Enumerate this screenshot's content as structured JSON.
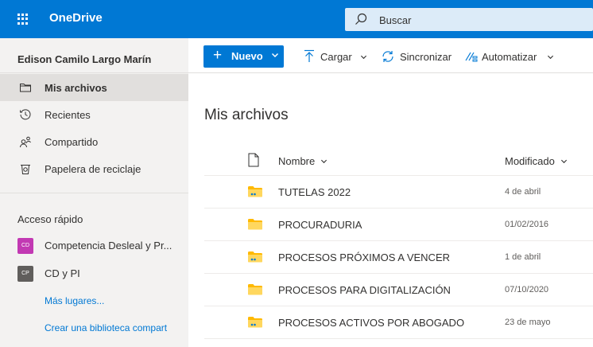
{
  "app": {
    "name": "OneDrive"
  },
  "search": {
    "placeholder": "Buscar"
  },
  "user": {
    "name": "Edison Camilo Largo Marín"
  },
  "nav": {
    "items": [
      {
        "label": "Mis archivos",
        "icon": "folder-icon",
        "active": true
      },
      {
        "label": "Recientes",
        "icon": "clock-icon",
        "active": false
      },
      {
        "label": "Compartido",
        "icon": "people-icon",
        "active": false
      },
      {
        "label": "Papelera de reciclaje",
        "icon": "recycle-bin-icon",
        "active": false
      }
    ]
  },
  "quick_access": {
    "title": "Acceso rápido",
    "items": [
      {
        "badge": "CD",
        "label": "Competencia Desleal y Pr...",
        "color": "#c239b3"
      },
      {
        "badge": "CP",
        "label": "CD y PI",
        "color": "#605e5c"
      }
    ],
    "more_places": "Más lugares...",
    "create_library": "Crear una biblioteca compart"
  },
  "toolbar": {
    "new_label": "Nuevo",
    "upload_label": "Cargar",
    "sync_label": "Sincronizar",
    "automate_label": "Automatizar"
  },
  "main": {
    "title": "Mis archivos",
    "columns": {
      "name": "Nombre",
      "modified": "Modificado"
    },
    "files": [
      {
        "name": "TUTELAS 2022",
        "modified": "4 de abril",
        "shared": true
      },
      {
        "name": "PROCURADURIA",
        "modified": "01/02/2016",
        "shared": false
      },
      {
        "name": "PROCESOS PRÓXIMOS A VENCER",
        "modified": "1 de abril",
        "shared": true
      },
      {
        "name": "PROCESOS PARA DIGITALIZACIÓN",
        "modified": "07/10/2020",
        "shared": false
      },
      {
        "name": "PROCESOS ACTIVOS POR ABOGADO",
        "modified": "23 de mayo",
        "shared": true
      }
    ]
  },
  "colors": {
    "brand": "#0078d4",
    "nav_bg": "#f3f2f1",
    "folder": "#ffb900"
  }
}
